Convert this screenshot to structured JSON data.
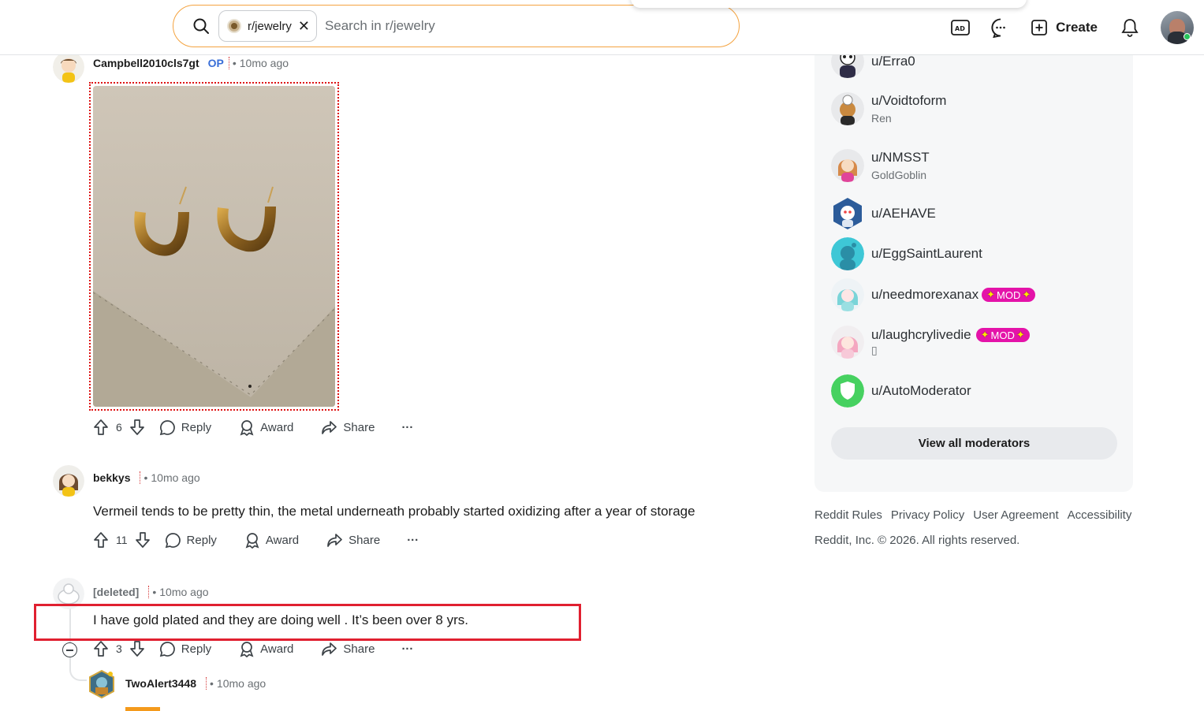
{
  "search": {
    "community_chip": "r/jewelry",
    "placeholder": "Search in r/jewelry"
  },
  "header": {
    "create_label": "Create"
  },
  "comments": [
    {
      "author": "Campbell2010cls7gt",
      "op_badge": "OP",
      "time": "10mo ago",
      "has_image": true,
      "score": "6",
      "reply_label": "Reply",
      "award_label": "Award",
      "share_label": "Share",
      "more_label": "···"
    },
    {
      "author": "bekkys",
      "time": "10mo ago",
      "text": "Vermeil tends to be pretty thin, the metal underneath probably started oxidizing after a year of storage",
      "score": "11",
      "reply_label": "Reply",
      "award_label": "Award",
      "share_label": "Share",
      "more_label": "···"
    },
    {
      "author": "[deleted]",
      "time": "10mo ago",
      "text": "I have gold plated and they are doing well . It’s been over 8 yrs.",
      "score": "3",
      "reply_label": "Reply",
      "award_label": "Award",
      "share_label": "Share",
      "more_label": "···"
    },
    {
      "author": "TwoAlert3448",
      "time": "10mo ago"
    }
  ],
  "sidebar": {
    "moderators": [
      {
        "name": "u/Erra0",
        "flair": ""
      },
      {
        "name": "u/Voidtoform",
        "flair": "Ren"
      },
      {
        "name": "u/NMSST",
        "flair": "GoldGoblin"
      },
      {
        "name": "u/AEHAVE",
        "flair": ""
      },
      {
        "name": "u/EggSaintLaurent",
        "flair": ""
      },
      {
        "name": "u/needmorexanax",
        "flair": "",
        "badge": "MOD"
      },
      {
        "name": "u/laughcrylivedie",
        "flair": "▯",
        "badge": "MOD"
      },
      {
        "name": "u/AutoModerator",
        "flair": ""
      }
    ],
    "view_all_label": "View all moderators",
    "footer_links": [
      "Reddit Rules",
      "Privacy Policy",
      "User Agreement",
      "Accessibility"
    ],
    "copyright": "Reddit, Inc. © 2026. All rights reserved."
  },
  "colors": {
    "search_border": "#f4a340",
    "op_blue": "#3a6fd8",
    "mod_badge": "#e413a9",
    "highlight_red": "#e02030",
    "online_green": "#27c35a"
  }
}
